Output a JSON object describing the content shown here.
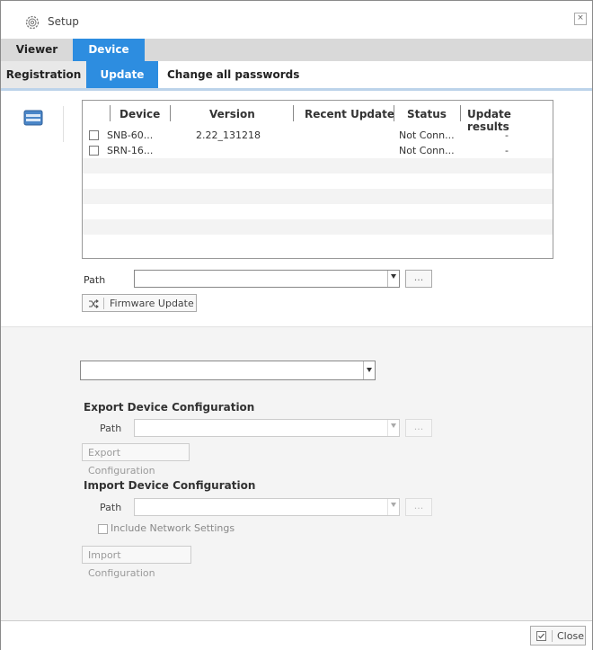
{
  "window": {
    "title": "Setup",
    "close_glyph": "×"
  },
  "top_tabs": [
    {
      "label": "Viewer"
    },
    {
      "label": "Device"
    }
  ],
  "sub_tabs": [
    {
      "label": "Registration"
    },
    {
      "label": "Update"
    },
    {
      "label": "Change all passwords"
    }
  ],
  "update": {
    "table": {
      "columns": [
        "Device",
        "Version",
        "Recent Update",
        "Status",
        "Update results"
      ],
      "rows": [
        {
          "device": "SNB-60...",
          "version": "2.22_131218",
          "recent_update": "",
          "status": "Not Conn...",
          "result": "-"
        },
        {
          "device": "SRN-16...",
          "version": "",
          "recent_update": "",
          "status": "Not Conn...",
          "result": "-"
        }
      ]
    },
    "path_label": "Path",
    "path_value": "",
    "browse_label": "...",
    "firmware_button": "Firmware Update"
  },
  "config": {
    "device_select_value": "",
    "export": {
      "title": "Export Device Configuration",
      "path_label": "Path",
      "path_value": "",
      "browse_label": "...",
      "button": "Export Configuration"
    },
    "import": {
      "title": "Import Device Configuration",
      "path_label": "Path",
      "path_value": "",
      "browse_label": "...",
      "include_network": "Include Network Settings",
      "button": "Import Configuration"
    }
  },
  "footer": {
    "close_label": "Close"
  },
  "colors": {
    "accent": "#2d8de0",
    "tab_bar": "#d9d9d9",
    "panel_gray": "#f4f4f4"
  }
}
